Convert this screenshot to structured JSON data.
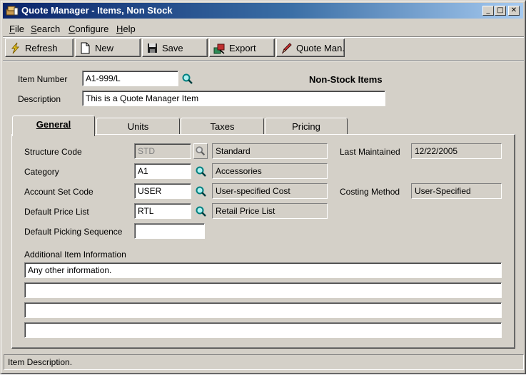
{
  "window": {
    "title": "Quote Manager - Items, Non Stock",
    "minimize_glyph": "_",
    "maximize_glyph": "□",
    "close_glyph": "✕"
  },
  "menu": [
    {
      "label": "File",
      "accel": "F"
    },
    {
      "label": "Search",
      "accel": "S"
    },
    {
      "label": "Configure",
      "accel": "C"
    },
    {
      "label": "Help",
      "accel": "H"
    }
  ],
  "toolbar": {
    "refresh": "Refresh",
    "new": "New",
    "save": "Save",
    "export": "Export",
    "quote_man": "Quote Man."
  },
  "header": {
    "item_number_label": "Item Number",
    "item_number_value": "A1-999/L",
    "section_title": "Non-Stock Items",
    "description_label": "Description",
    "description_value": "This is a Quote Manager Item"
  },
  "tabs": [
    {
      "label": "General",
      "active": true
    },
    {
      "label": "Units",
      "active": false
    },
    {
      "label": "Taxes",
      "active": false
    },
    {
      "label": "Pricing",
      "active": false
    }
  ],
  "general": {
    "structure_code_label": "Structure Code",
    "structure_code_value": "STD",
    "structure_code_desc": "Standard",
    "category_label": "Category",
    "category_value": "A1",
    "category_desc": "Accessories",
    "account_set_label": "Account Set Code",
    "account_set_value": "USER",
    "account_set_desc": "User-specified Cost",
    "price_list_label": "Default Price List",
    "price_list_value": "RTL",
    "price_list_desc": "Retail Price List",
    "picking_seq_label": "Default Picking Sequence",
    "picking_seq_value": "",
    "last_maintained_label": "Last Maintained",
    "last_maintained_value": "12/22/2005",
    "costing_method_label": "Costing Method",
    "costing_method_value": "User-Specified",
    "additional_info_label": "Additional Item Information",
    "additional_info_lines": [
      "Any other information.",
      "",
      "",
      ""
    ]
  },
  "status_bar": {
    "text": "Item Description."
  },
  "colors": {
    "face": "#d4d0c8",
    "titlebar_start": "#0a246a",
    "titlebar_end": "#a6caf0",
    "search_icon": "#008080"
  }
}
